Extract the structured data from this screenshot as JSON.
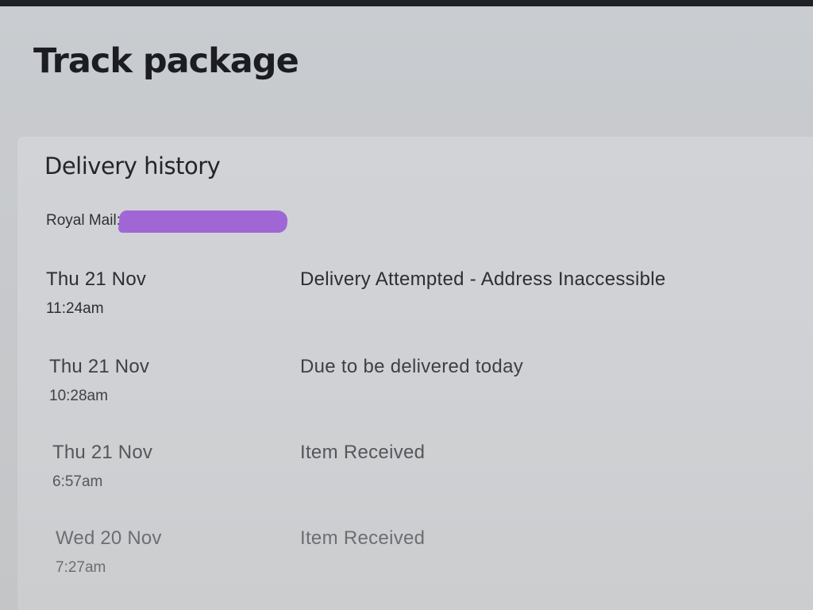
{
  "page": {
    "title": "Track package"
  },
  "delivery_history": {
    "title": "Delivery history",
    "carrier_label": "Royal Mail:",
    "tracking_number_redacted": true,
    "redaction_color": "#a066d6",
    "events": [
      {
        "date": "Thu 21 Nov",
        "time": "11:24am",
        "status": "Delivery Attempted - Address Inaccessible"
      },
      {
        "date": "Thu 21 Nov",
        "time": "10:28am",
        "status": "Due to be delivered today"
      },
      {
        "date": "Thu 21 Nov",
        "time": "6:57am",
        "status": "Item Received"
      },
      {
        "date": "Wed 20 Nov",
        "time": "7:27am",
        "status": "Item Received"
      }
    ]
  }
}
